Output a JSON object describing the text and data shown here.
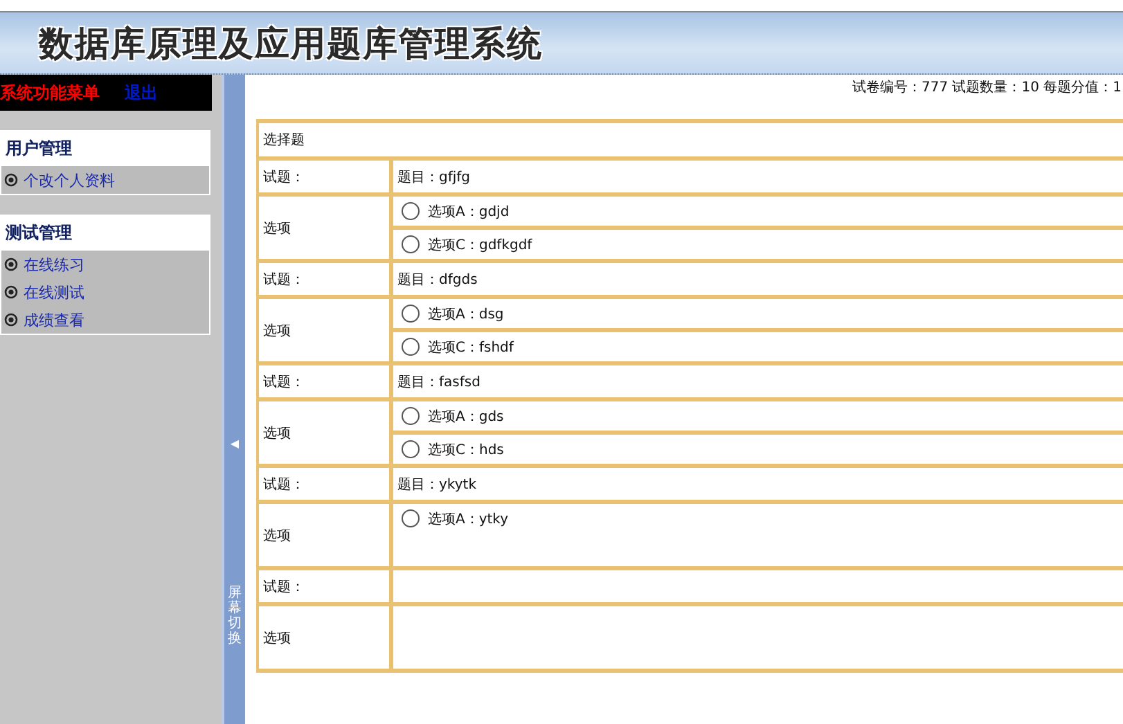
{
  "header": {
    "title": "数据库原理及应用题库管理系统"
  },
  "sidebar": {
    "menu_title": "系统功能菜单",
    "logout": "退出",
    "groups": [
      {
        "title": "用户管理",
        "items": [
          {
            "label": "个改个人资料"
          }
        ]
      },
      {
        "title": "测试管理",
        "items": [
          {
            "label": "在线练习"
          },
          {
            "label": "在线测试"
          },
          {
            "label": "成绩查看"
          }
        ]
      }
    ]
  },
  "splitter": {
    "arrow": "◀",
    "label": "屏幕切换"
  },
  "exam_info": "试卷编号：777 试题数量：10 每题分值：1",
  "section_title": "选择题",
  "questions": [
    {
      "label": "试题：",
      "prompt": "题目：gfjfg",
      "options_label": "选项",
      "options": [
        {
          "text": "选项A：gdjd",
          "selected": false
        },
        {
          "text": "选项C：gdfkgdf",
          "selected": false
        }
      ]
    },
    {
      "label": "试题：",
      "prompt": "题目：dfgds",
      "options_label": "选项",
      "options": [
        {
          "text": "选项A：dsg",
          "selected": false
        },
        {
          "text": "选项C：fshdf",
          "selected": false
        }
      ]
    },
    {
      "label": "试题：",
      "prompt": "题目：fasfsd",
      "options_label": "选项",
      "options": [
        {
          "text": "选项A：gds",
          "selected": false
        },
        {
          "text": "选项C：hds",
          "selected": false
        }
      ]
    },
    {
      "label": "试题：",
      "prompt": "题目：ykytk",
      "options_label": "选项",
      "options": [
        {
          "text": "选项A：ytky",
          "selected": false
        }
      ]
    },
    {
      "label": "试题：",
      "options_label": "选项"
    }
  ]
}
